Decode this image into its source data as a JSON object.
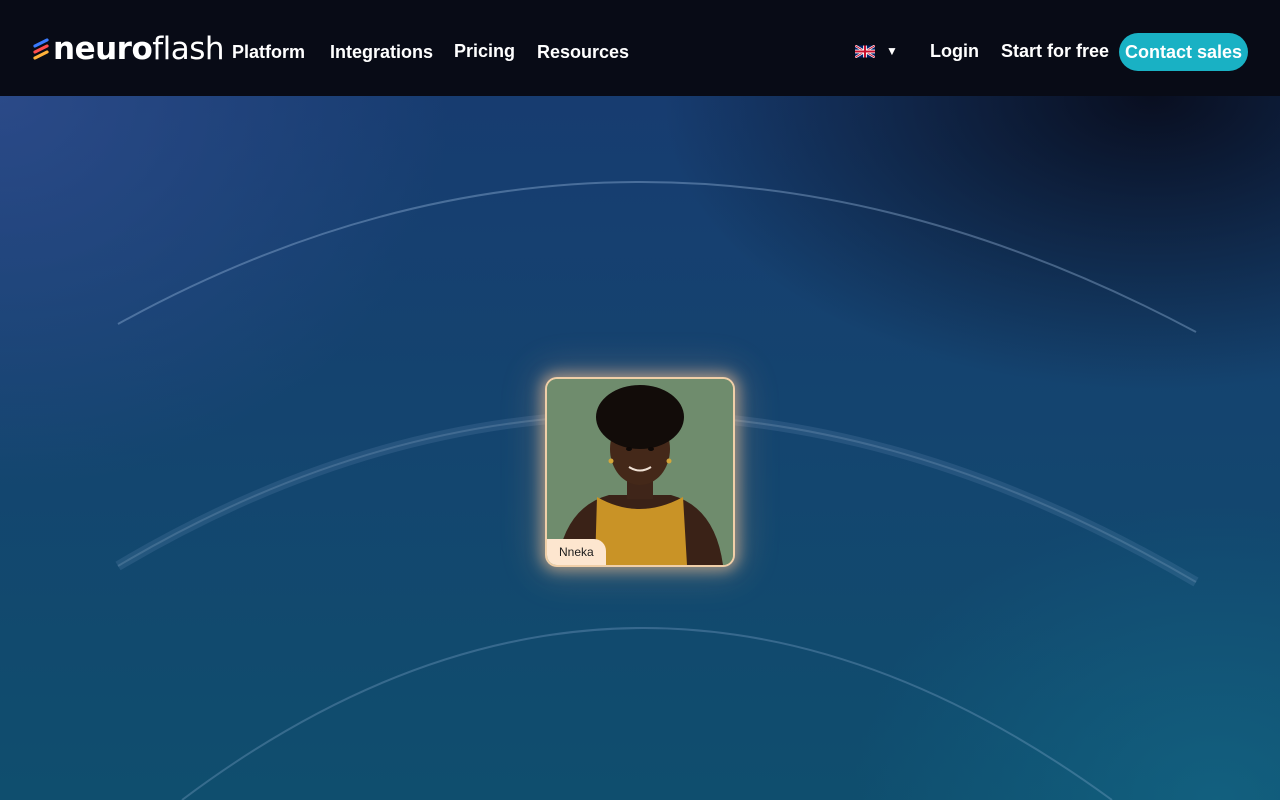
{
  "brand": {
    "name_bold": "neuro",
    "name_light": "flash",
    "mark_colors": [
      "#3a7bff",
      "#ff4d4d",
      "#ffb23a"
    ]
  },
  "nav": {
    "items": [
      {
        "label": "Platform"
      },
      {
        "label": "Integrations"
      },
      {
        "label": "Pricing"
      },
      {
        "label": "Resources"
      }
    ],
    "language_icon": "uk-flag-icon",
    "login": "Login",
    "start_free": "Start for free",
    "contact_sales": "Contact sales"
  },
  "hero": {
    "persona": {
      "name": "Nneka"
    }
  },
  "colors": {
    "header_bg": "#080b16",
    "accent": "#19b1c4",
    "label_bg": "#fde6cf",
    "card_glow": "#ffc896"
  }
}
